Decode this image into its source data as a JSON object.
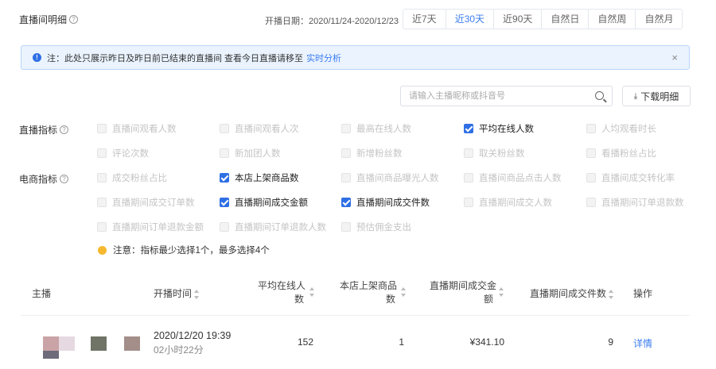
{
  "header": {
    "title": "直播间明细",
    "date_label": "开播日期：2020/11/24-2020/12/23",
    "ranges": [
      "近7天",
      "近30天",
      "近90天",
      "自然日",
      "自然周",
      "自然月"
    ],
    "active_range": "近30天"
  },
  "notice": {
    "text": "注：此处只展示昨日及昨日前已结束的直播间 查看今日直播请移至",
    "link": "实时分析",
    "close": "×"
  },
  "search": {
    "placeholder": "请输入主播昵称或抖音号"
  },
  "download": {
    "label": "下载明细",
    "icon": "download-icon"
  },
  "live_metrics": {
    "label": "直播指标",
    "items": [
      {
        "label": "直播间观看人数",
        "checked": false
      },
      {
        "label": "直播间观看人次",
        "checked": false
      },
      {
        "label": "最高在线人数",
        "checked": false
      },
      {
        "label": "平均在线人数",
        "checked": true
      },
      {
        "label": "人均观看时长",
        "checked": false
      },
      {
        "label": "评论次数",
        "checked": false
      },
      {
        "label": "新加团人数",
        "checked": false
      },
      {
        "label": "新增粉丝数",
        "checked": false
      },
      {
        "label": "取关粉丝数",
        "checked": false
      },
      {
        "label": "看播粉丝占比",
        "checked": false
      }
    ]
  },
  "ecom_metrics": {
    "label": "电商指标",
    "items": [
      {
        "label": "成交粉丝占比",
        "checked": false
      },
      {
        "label": "本店上架商品数",
        "checked": true
      },
      {
        "label": "直播间商品曝光人数",
        "checked": false
      },
      {
        "label": "直播间商品点击人数",
        "checked": false
      },
      {
        "label": "直播间成交转化率",
        "checked": false
      },
      {
        "label": "直播期间成交订单数",
        "checked": false
      },
      {
        "label": "直播期间成交金额",
        "checked": true
      },
      {
        "label": "直播期间成交件数",
        "checked": true
      },
      {
        "label": "直播期间成交人数",
        "checked": false
      },
      {
        "label": "直播期间订单退款数",
        "checked": false
      },
      {
        "label": "直播期间订单退款金额",
        "checked": false
      },
      {
        "label": "直播期间订单退款人数",
        "checked": false
      },
      {
        "label": "预估佣金支出",
        "checked": false
      }
    ]
  },
  "warning": "注意：指标最少选择1个，最多选择4个",
  "table": {
    "columns": {
      "anchor": "主播",
      "start_time": "开播时间",
      "avg_online": [
        "平均在线人",
        "数"
      ],
      "shop_items": [
        "本店上架商品",
        "数"
      ],
      "gmv": [
        "直播期间成交金",
        "额"
      ],
      "items_sold": "直播期间成交件数",
      "action": "操作"
    },
    "rows": [
      {
        "start_time": "2020/12/20 19:39",
        "duration": "02小时22分",
        "avg_online": "152",
        "shop_items": "1",
        "gmv": "¥341.10",
        "items_sold": "9",
        "action": "详情"
      }
    ]
  },
  "colors": {
    "accent": "#3b7cf0",
    "checked": "#2f6fe4",
    "notice_bg": "#eaf3fe",
    "warning": "#f5b82e"
  }
}
